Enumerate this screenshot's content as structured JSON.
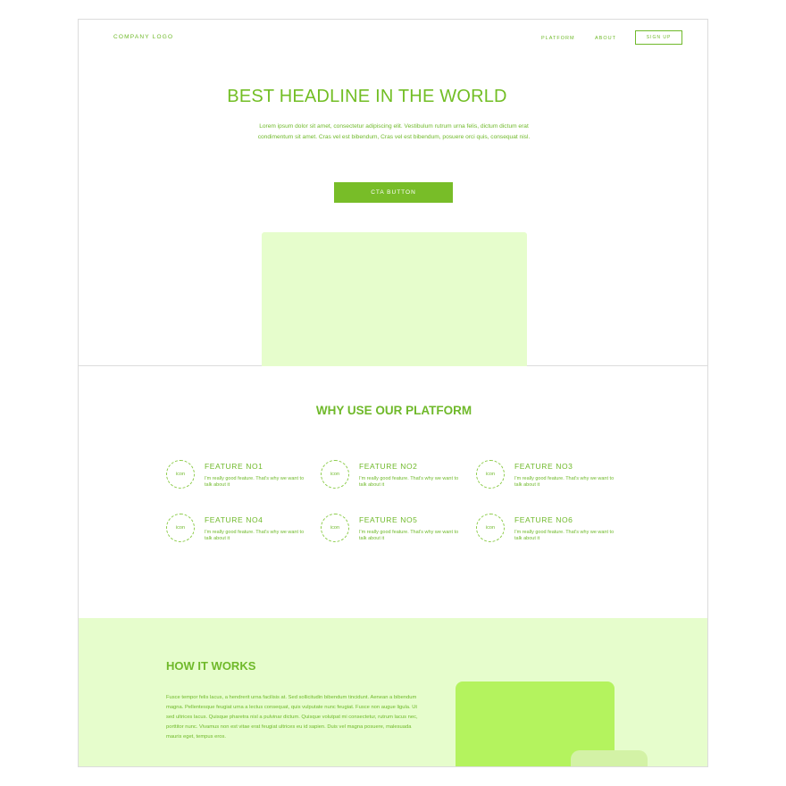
{
  "header": {
    "logo": "COMPANY LOGO",
    "nav": [
      "PLATFORM",
      "ABOUT"
    ],
    "signup": "SIGN UP"
  },
  "hero": {
    "headline": "BEST HEADLINE IN THE WORLD",
    "lead": "Lorem ipsum dolor sit amet, consectetur adipiscing elit. Vestibulum rutrum urna felis, dictum dictum erat condimentum sit amet. Cras vel est bibendum, Cras vel est bibendum, posuere orci quis, consequat nisl.",
    "cta": "CTA BUTTON"
  },
  "why": {
    "title": "WHY USE OUR PLATFORM",
    "icon_label": "icon",
    "features": [
      {
        "title": "FEATURE NO1",
        "desc": "I'm really good feature. That's why we want to talk about it"
      },
      {
        "title": "FEATURE NO2",
        "desc": "I'm really good feature. That's why we want to talk about it"
      },
      {
        "title": "FEATURE NO3",
        "desc": "I'm really good feature. That's why we want to talk about it"
      },
      {
        "title": "FEATURE NO4",
        "desc": "I'm really good feature. That's why we want to talk about it"
      },
      {
        "title": "FEATURE NO5",
        "desc": "I'm really good feature. That's why we want to talk about it"
      },
      {
        "title": "FEATURE NO6",
        "desc": "I'm really good feature. That's why we want to talk about it"
      }
    ]
  },
  "how": {
    "title": "HOW IT WORKS",
    "body": "Fusce tempor felis lacus, a hendrerit urna facilisis at. Sed sollicitudin bibendum tincidunt. Aenean a bibendum magna. Pellentesque feugiat urna a lectus consequat, quis vulputate nunc feugiat. Fusce non augue ligula. Ut sed ultrices lacus. Quisque pharetra nisl a pulvinar dictum. Quisque volutpat mi consectetur, rutrum lacus nec, porttitor nunc. Vivamus non est vitae erat feugiat ultrices eu id sapien. Duis vel magna posuere, malesuada mauris eget, tempus eros."
  },
  "colors": {
    "accent": "#72be24",
    "cta_bg": "#78bd28",
    "pale_green": "#e6fdcc",
    "bright_green": "#b4f35e"
  }
}
